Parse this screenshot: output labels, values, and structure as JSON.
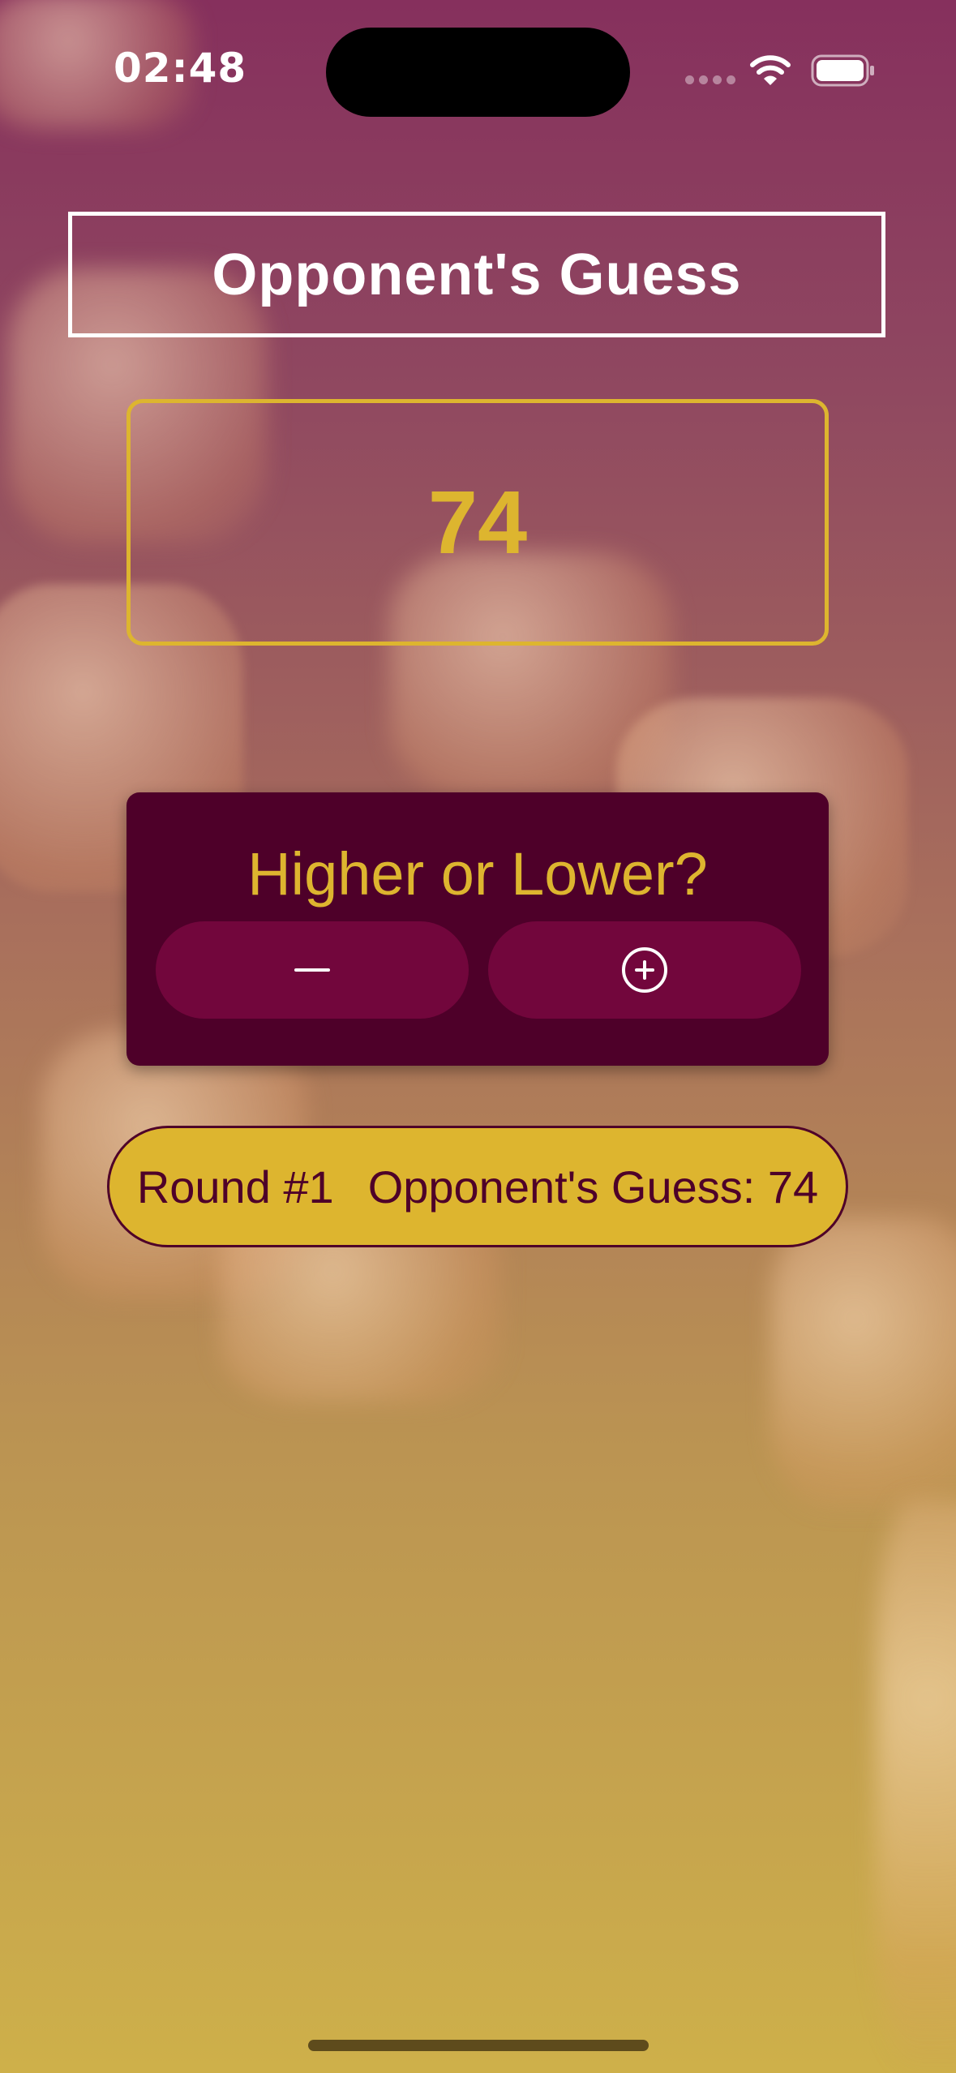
{
  "status_bar": {
    "time": "02:48"
  },
  "header": {
    "title": "Opponent's Guess"
  },
  "guess": {
    "number": "74"
  },
  "controls": {
    "prompt": "Higher or Lower?",
    "lower_icon": "minus-icon",
    "higher_icon": "plus-circle-icon"
  },
  "log": {
    "round": "Round #1",
    "guess_text": "Opponent's Guess: 74"
  },
  "colors": {
    "primary_dark": "#4e0029",
    "button": "#72063c",
    "accent": "#ddb52f",
    "white": "#ffffff"
  }
}
